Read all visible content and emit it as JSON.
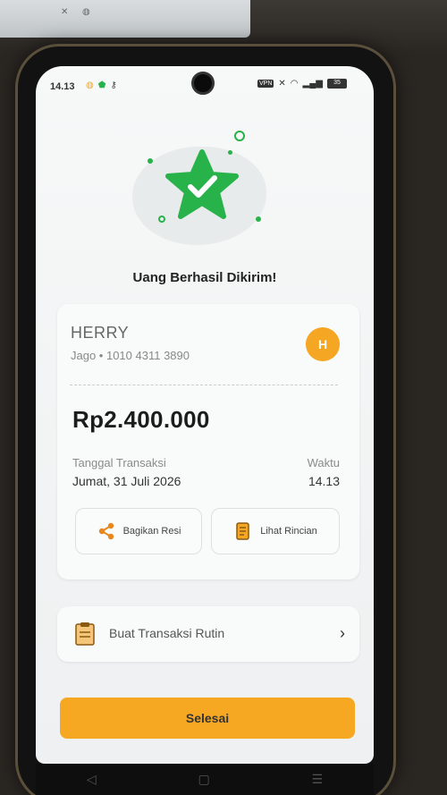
{
  "status_bar": {
    "time": "14.13",
    "vpn_badge": "VPN",
    "battery": "35",
    "icons": [
      "notification-icon",
      "shield-icon",
      "key-icon",
      "mute-icon",
      "wifi-icon",
      "signal-icon",
      "battery-icon"
    ]
  },
  "success": {
    "title": "Uang Berhasil Dikirim!",
    "accent_color": "#27b24a"
  },
  "recipient": {
    "name": "HERRY",
    "account": "Jago • 1010 4311 3890",
    "avatar_initial": "H",
    "avatar_color": "#f5a623"
  },
  "transaction": {
    "amount": "Rp2.400.000",
    "date_label": "Tanggal Transaksi",
    "date_value": "Jumat, 31 Juli 2026",
    "time_label": "Waktu",
    "time_value": "14.13"
  },
  "actions": {
    "share_label": "Bagikan Resi",
    "details_label": "Lihat Rincian"
  },
  "recurring": {
    "label": "Buat Transaksi Rutin"
  },
  "primary_button": {
    "label": "Selesai",
    "color": "#f7a823"
  },
  "nav": {
    "back": "◁",
    "home": "▢",
    "menu": "☰"
  }
}
